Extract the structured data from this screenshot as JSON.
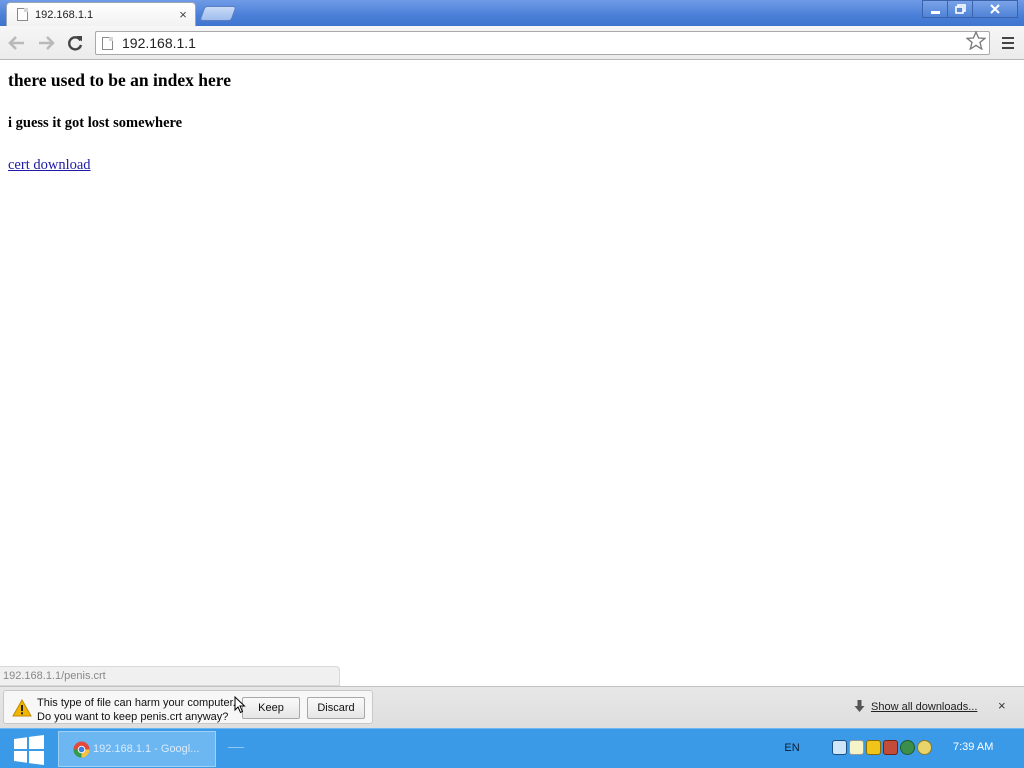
{
  "browser": {
    "tab": {
      "title": "192.168.1.1",
      "close_glyph": "×"
    },
    "omnibox": {
      "url": "192.168.1.1"
    },
    "status_url": "192.168.1.1/penis.crt"
  },
  "page": {
    "heading": "there used to be an index here",
    "subheading": "i guess it got lost somewhere",
    "link_text": "cert download"
  },
  "download_shelf": {
    "warning_line1": "This type of file can harm your computer.",
    "warning_line2": "Do you want to keep penis.crt anyway?",
    "keep_label": "Keep",
    "discard_label": "Discard",
    "show_all_label": "Show all downloads...",
    "close_glyph": "×"
  },
  "taskbar": {
    "app_label": "192.168.1.1 - Googl...",
    "language": "EN",
    "clock": "7:39 AM"
  },
  "colors": {
    "titlebar": "#4a7fd8",
    "link": "#1f1aa8",
    "taskbar": "#3a9ae8",
    "warning": "#f2b600"
  },
  "icons": [
    "back-arrow-icon",
    "forward-arrow-icon",
    "reload-icon",
    "page-icon",
    "star-icon",
    "menu-icon",
    "warning-icon",
    "download-arrow-icon",
    "windows-logo-icon",
    "chrome-icon"
  ]
}
